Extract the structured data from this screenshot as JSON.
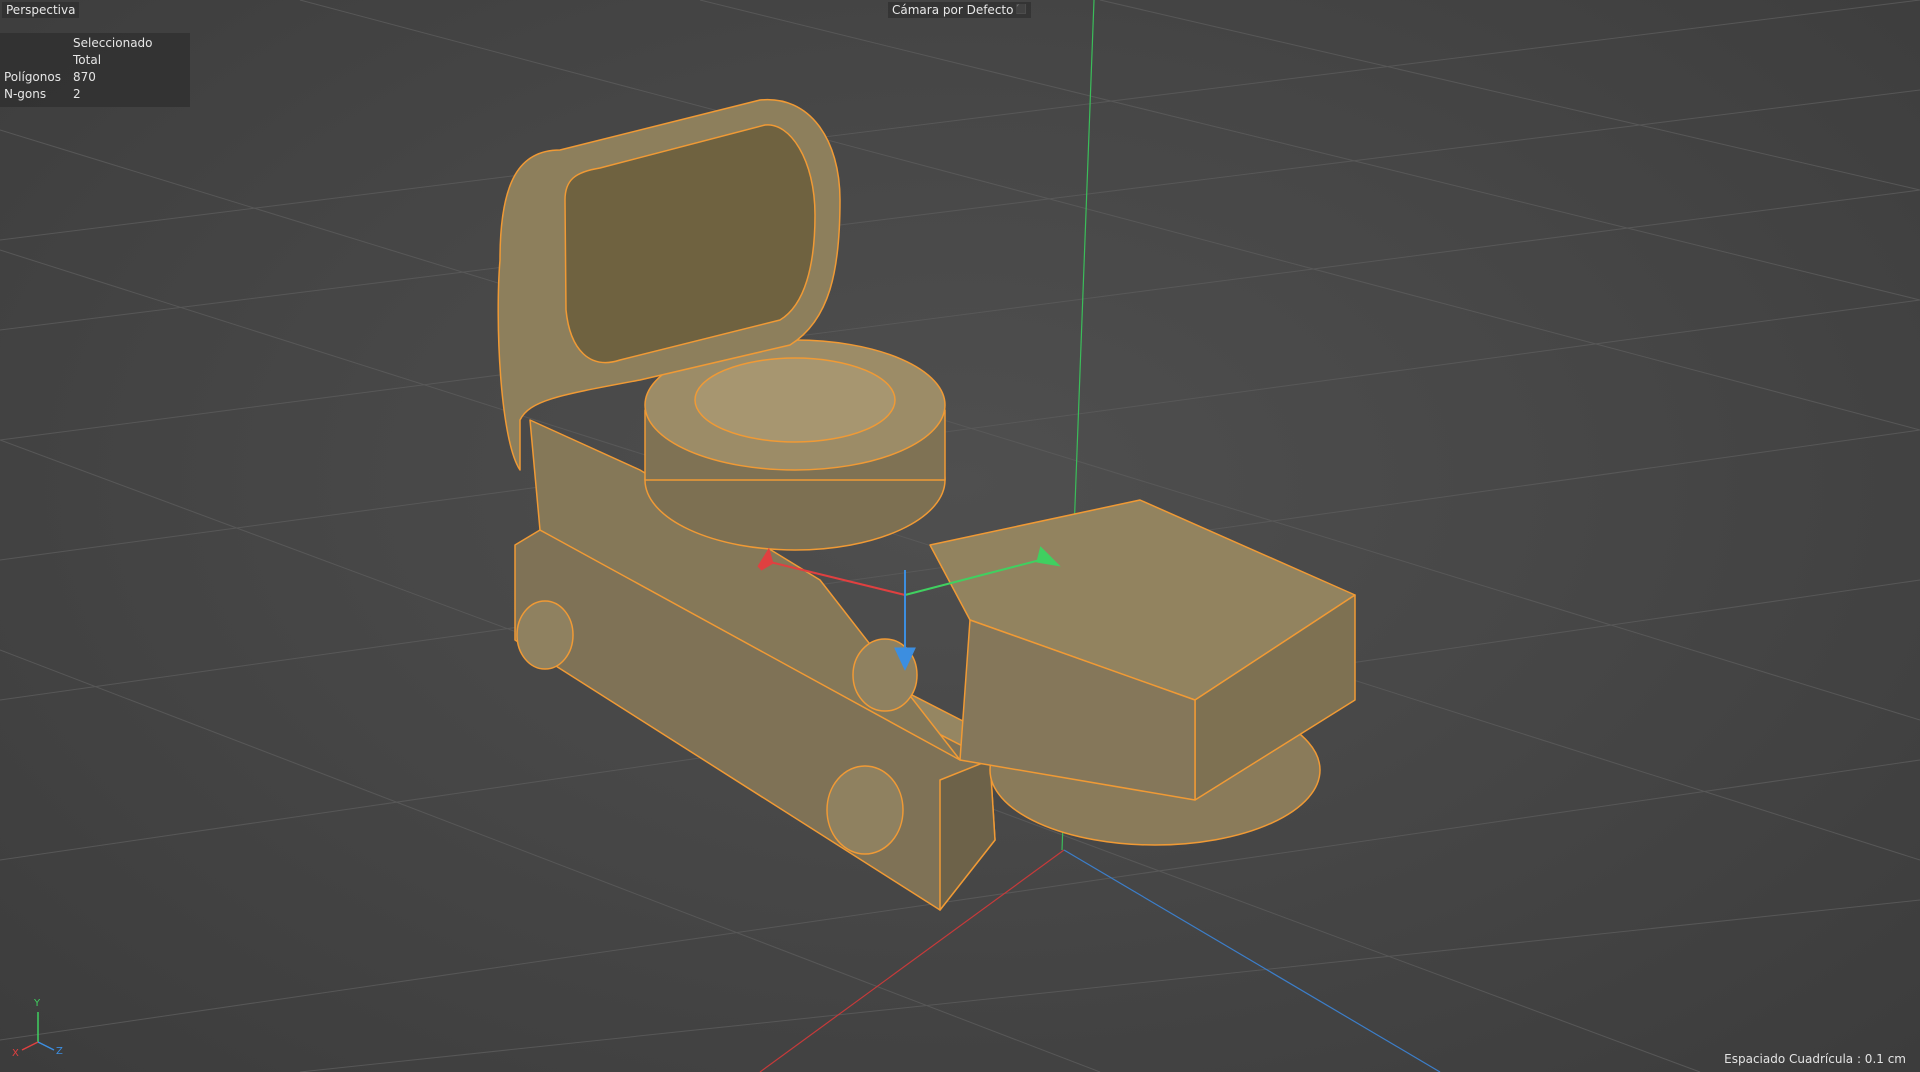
{
  "viewport": {
    "view_name": "Perspectiva",
    "camera_name": "Cámara por Defecto",
    "camera_icon": "camera-options-icon",
    "grid_spacing": "Espaciado Cuadrícula : 0.1 cm"
  },
  "stats": {
    "header_selected_total": "Seleccionado Total",
    "rows": [
      {
        "label": "Polígonos",
        "value": "870"
      },
      {
        "label": "N-gons",
        "value": "2"
      }
    ]
  },
  "axis_gizmo": {
    "x": "X",
    "y": "Y",
    "z": "Z"
  },
  "colors": {
    "background": "#444444",
    "mesh_fill": "#8a7a5a",
    "mesh_edge": "#f0a040",
    "axis_x": "#e04040",
    "axis_y": "#40d060",
    "axis_z": "#3c8ee0"
  }
}
